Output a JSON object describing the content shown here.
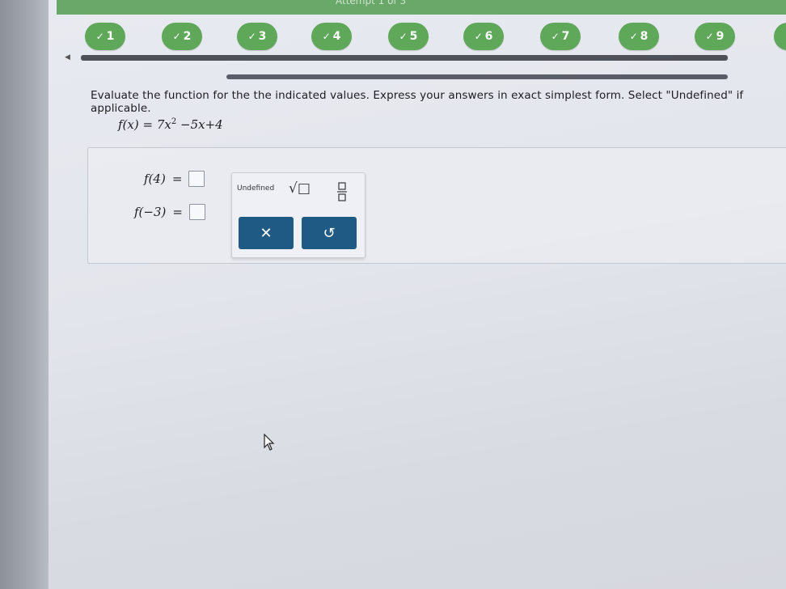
{
  "header": {
    "title": "Attempt 1 of 3"
  },
  "steps": [
    {
      "label": "1",
      "done": true
    },
    {
      "label": "2",
      "done": true
    },
    {
      "label": "3",
      "done": true
    },
    {
      "label": "4",
      "done": true
    },
    {
      "label": "5",
      "done": true
    },
    {
      "label": "6",
      "done": true
    },
    {
      "label": "7",
      "done": true
    },
    {
      "label": "8",
      "done": true
    },
    {
      "label": "9",
      "done": true
    }
  ],
  "question": {
    "instructions": "Evaluate the function for the the indicated values. Express your answers in exact simplest form. Select \"Undefined\" if applicable.",
    "function_lhs": "f(x)",
    "function_rhs_a": "7x",
    "function_rhs_exp": "2",
    "function_rhs_b": "−5x+4",
    "parts": [
      {
        "lhs": "f(4)",
        "eq": "="
      },
      {
        "lhs": "f(−3)",
        "eq": "="
      }
    ]
  },
  "keypad": {
    "undefined_label": "Undefined",
    "sqrt_label": "√□",
    "clear_label": "✕",
    "undo_label": "↺"
  },
  "colors": {
    "step_green": "#5fa85a",
    "keypad_button": "#1f5a84",
    "top_bar": "#6aa86a"
  }
}
